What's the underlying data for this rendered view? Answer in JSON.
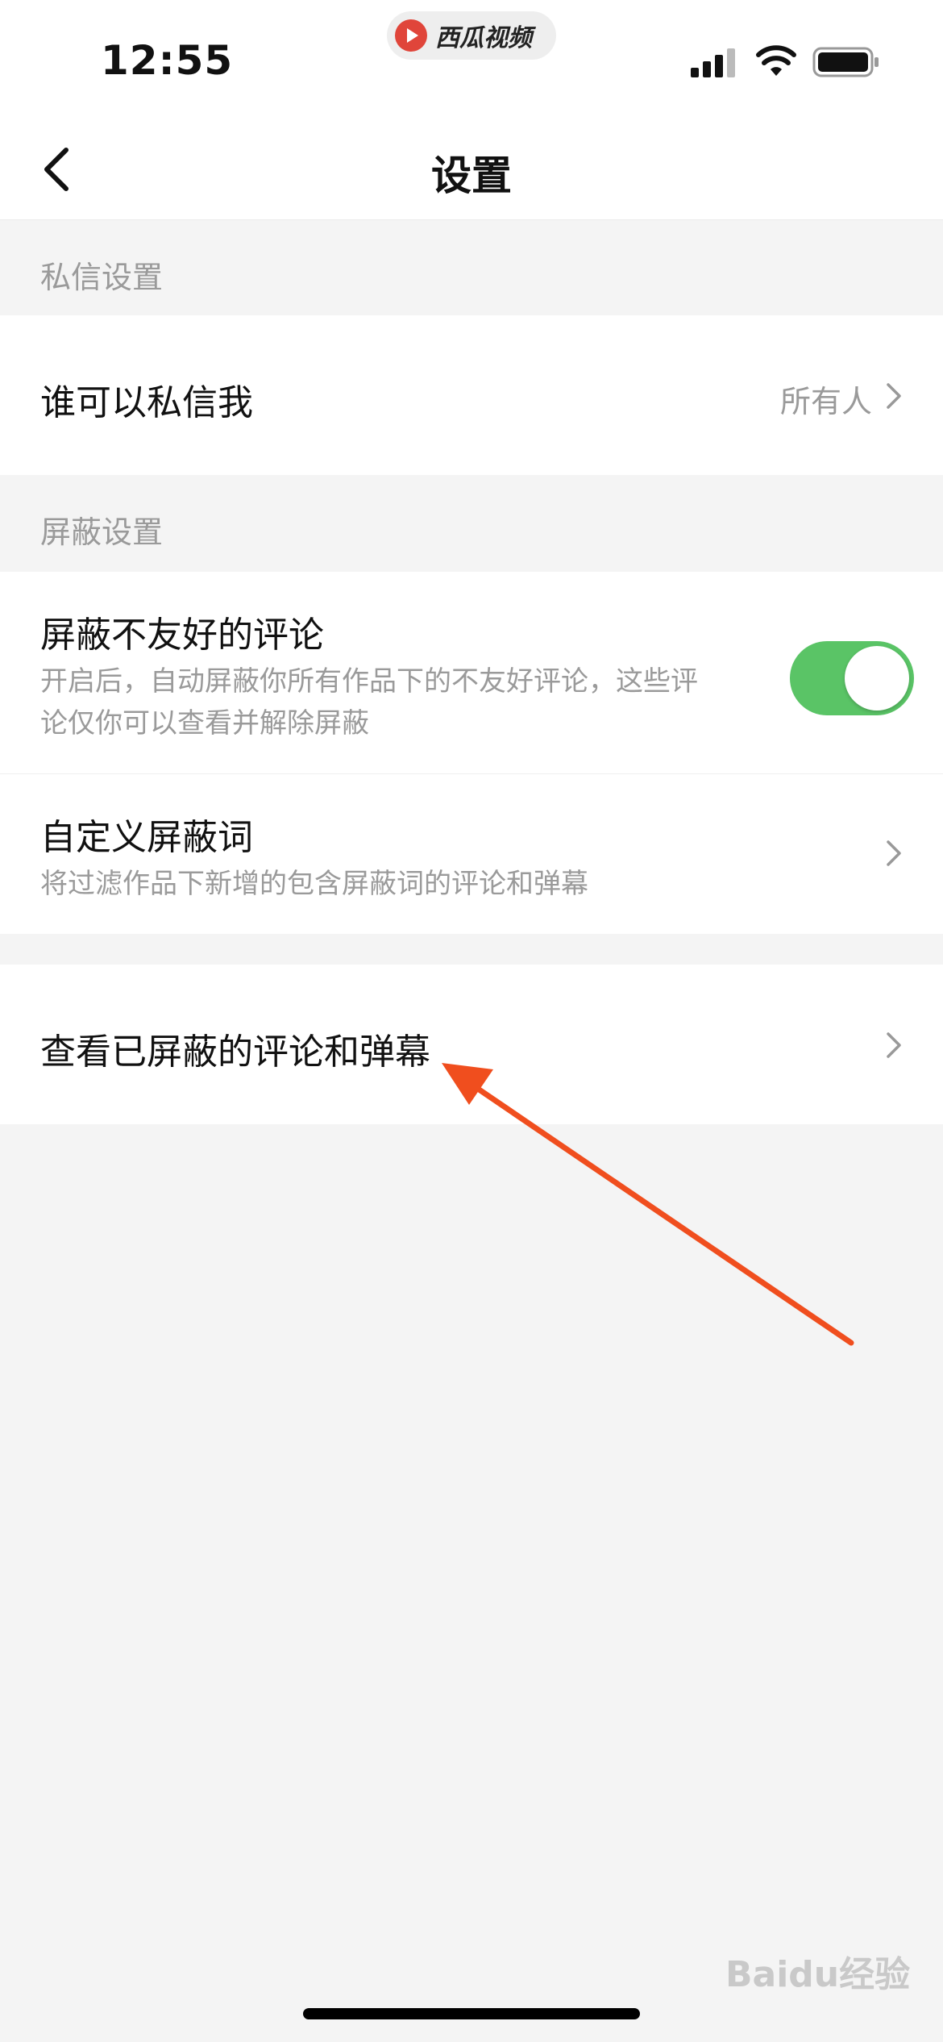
{
  "status_bar": {
    "time": "12:55",
    "app_name": "西瓜视频"
  },
  "nav": {
    "title": "设置"
  },
  "sections": {
    "private_message": {
      "header": "私信设置",
      "who_can_message": {
        "label": "谁可以私信我",
        "value": "所有人"
      }
    },
    "block": {
      "header": "屏蔽设置",
      "block_unfriendly": {
        "label": "屏蔽不友好的评论",
        "desc_line1": "开启后，自动屏蔽你所有作品下的不友好评论，这些评",
        "desc_line2": "论仅你可以查看并解除屏蔽",
        "enabled": true
      },
      "custom_words": {
        "label": "自定义屏蔽词",
        "desc": "将过滤作品下新增的包含屏蔽词的评论和弹幕"
      }
    },
    "view_blocked": {
      "label": "查看已屏蔽的评论和弹幕"
    }
  },
  "colors": {
    "toggle_on": "#5ac466",
    "annotation_arrow": "#f04e1e"
  },
  "watermark": "Baidu经验"
}
